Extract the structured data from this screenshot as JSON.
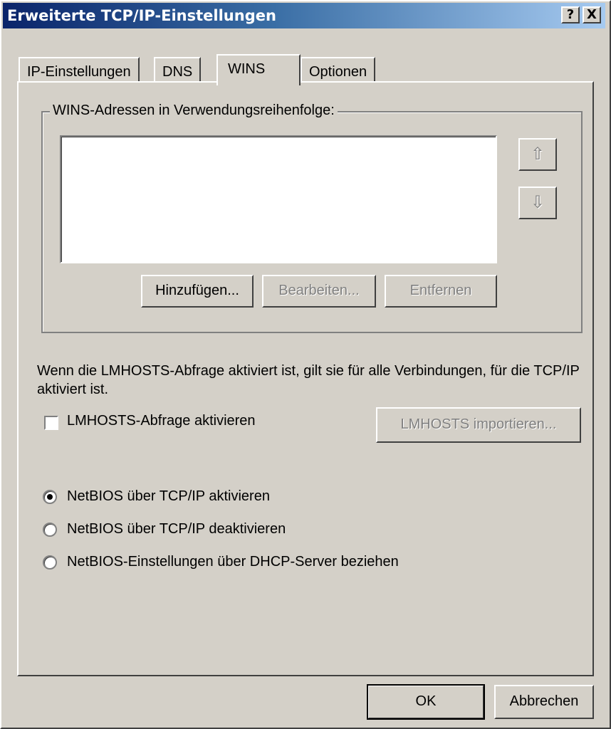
{
  "window": {
    "title": "Erweiterte TCP/IP-Einstellungen",
    "help_label": "?",
    "close_label": "X"
  },
  "tabs": [
    {
      "label": "IP-Einstellungen",
      "active": false
    },
    {
      "label": "DNS",
      "active": false
    },
    {
      "label": "WINS",
      "active": true
    },
    {
      "label": "Optionen",
      "active": false
    }
  ],
  "wins": {
    "group_label": "WINS-Adressen in Verwendungsreihenfolge:",
    "addresses": [],
    "up_icon": "arrow-up-icon",
    "down_icon": "arrow-down-icon",
    "add_label": "Hinzufügen...",
    "edit_label": "Bearbeiten...",
    "remove_label": "Entfernen"
  },
  "lmhosts": {
    "info": "Wenn die LMHOSTS-Abfrage aktiviert ist, gilt sie für alle Verbindungen, für die TCP/IP aktiviert ist.",
    "checkbox_label": "LMHOSTS-Abfrage aktivieren",
    "checked": false,
    "import_label": "LMHOSTS importieren..."
  },
  "netbios": {
    "options": [
      {
        "label": "NetBIOS über TCP/IP aktivieren",
        "selected": true
      },
      {
        "label": "NetBIOS über TCP/IP deaktivieren",
        "selected": false
      },
      {
        "label": "NetBIOS-Einstellungen über DHCP-Server beziehen",
        "selected": false
      }
    ]
  },
  "footer": {
    "ok_label": "OK",
    "cancel_label": "Abbrechen"
  },
  "colors": {
    "face": "#d4d0c8",
    "title_start": "#0a246a",
    "title_end": "#a6caf0",
    "disabled_text": "#808080"
  }
}
